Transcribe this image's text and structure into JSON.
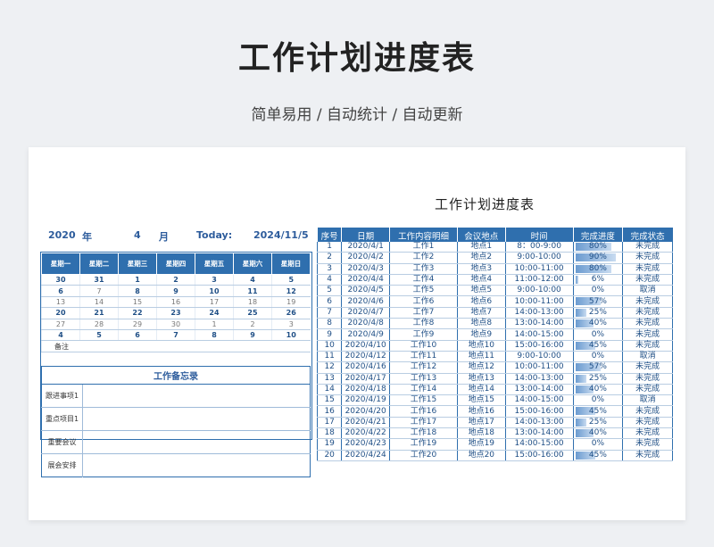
{
  "header": {
    "title": "工作计划进度表",
    "subtitle": "简单易用  /  自动统计  /  自动更新"
  },
  "sheet": {
    "title": "工作计划进度表",
    "year": "2020",
    "year_unit": "年",
    "month": "4",
    "month_unit": "月",
    "today_label": "Today:",
    "today_value": "2024/11/5"
  },
  "calendar": {
    "weekdays": [
      "星期一",
      "星期二",
      "星期三",
      "星期四",
      "星期五",
      "星期六",
      "星期日"
    ],
    "weeks": [
      [
        {
          "d": "30",
          "m": false
        },
        {
          "d": "31",
          "m": false
        },
        {
          "d": "1",
          "m": false
        },
        {
          "d": "2",
          "m": false
        },
        {
          "d": "3",
          "m": false
        },
        {
          "d": "4",
          "m": false
        },
        {
          "d": "5",
          "m": false
        }
      ],
      [
        {
          "d": "6",
          "m": false
        },
        {
          "d": "7",
          "m": true
        },
        {
          "d": "8",
          "m": false
        },
        {
          "d": "9",
          "m": false
        },
        {
          "d": "10",
          "m": false
        },
        {
          "d": "11",
          "m": false
        },
        {
          "d": "12",
          "m": false
        }
      ],
      [
        {
          "d": "13",
          "m": true
        },
        {
          "d": "14",
          "m": true
        },
        {
          "d": "15",
          "m": true
        },
        {
          "d": "16",
          "m": true
        },
        {
          "d": "17",
          "m": true
        },
        {
          "d": "18",
          "m": true
        },
        {
          "d": "19",
          "m": true
        }
      ],
      [
        {
          "d": "20",
          "m": false
        },
        {
          "d": "21",
          "m": false
        },
        {
          "d": "22",
          "m": false
        },
        {
          "d": "23",
          "m": false
        },
        {
          "d": "24",
          "m": false
        },
        {
          "d": "25",
          "m": false
        },
        {
          "d": "26",
          "m": false
        }
      ],
      [
        {
          "d": "27",
          "m": true
        },
        {
          "d": "28",
          "m": true
        },
        {
          "d": "29",
          "m": true
        },
        {
          "d": "30",
          "m": true
        },
        {
          "d": "1",
          "m": true
        },
        {
          "d": "2",
          "m": true
        },
        {
          "d": "3",
          "m": true
        }
      ],
      [
        {
          "d": "4",
          "m": false
        },
        {
          "d": "5",
          "m": false
        },
        {
          "d": "6",
          "m": false
        },
        {
          "d": "7",
          "m": false
        },
        {
          "d": "8",
          "m": false
        },
        {
          "d": "9",
          "m": false
        },
        {
          "d": "10",
          "m": false
        }
      ]
    ],
    "note_label": "备注"
  },
  "memo": {
    "title": "工作备忘录",
    "rows": [
      "跟进事项1",
      "重点项目1",
      "重要会议",
      "展会安排"
    ]
  },
  "plan": {
    "headers": [
      "序号",
      "日期",
      "工作内容明细",
      "会议地点",
      "时间",
      "完成进度",
      "完成状态"
    ],
    "rows": [
      [
        "1",
        "2020/4/1",
        "工作1",
        "地点1",
        "8：00-9:00",
        "80%",
        0.8,
        "未完成"
      ],
      [
        "2",
        "2020/4/2",
        "工作2",
        "地点2",
        "9:00-10:00",
        "90%",
        0.9,
        "未完成"
      ],
      [
        "3",
        "2020/4/3",
        "工作3",
        "地点3",
        "10:00-11:00",
        "80%",
        0.8,
        "未完成"
      ],
      [
        "4",
        "2020/4/4",
        "工作4",
        "地点4",
        "11:00-12:00",
        "6%",
        0.06,
        "未完成"
      ],
      [
        "5",
        "2020/4/5",
        "工作5",
        "地点5",
        "9:00-10:00",
        "0%",
        0,
        "取消"
      ],
      [
        "6",
        "2020/4/6",
        "工作6",
        "地点6",
        "10:00-11:00",
        "57%",
        0.57,
        "未完成"
      ],
      [
        "7",
        "2020/4/7",
        "工作7",
        "地点7",
        "14:00-13:00",
        "25%",
        0.25,
        "未完成"
      ],
      [
        "8",
        "2020/4/8",
        "工作8",
        "地点8",
        "13:00-14:00",
        "40%",
        0.4,
        "未完成"
      ],
      [
        "9",
        "2020/4/9",
        "工作9",
        "地点9",
        "14:00-15:00",
        "0%",
        0,
        "未完成"
      ],
      [
        "10",
        "2020/4/10",
        "工作10",
        "地点10",
        "15:00-16:00",
        "45%",
        0.45,
        "未完成"
      ],
      [
        "11",
        "2020/4/12",
        "工作11",
        "地点11",
        "9:00-10:00",
        "0%",
        0,
        "取消"
      ],
      [
        "12",
        "2020/4/16",
        "工作12",
        "地点12",
        "10:00-11:00",
        "57%",
        0.57,
        "未完成"
      ],
      [
        "13",
        "2020/4/17",
        "工作13",
        "地点13",
        "14:00-13:00",
        "25%",
        0.25,
        "未完成"
      ],
      [
        "14",
        "2020/4/18",
        "工作14",
        "地点14",
        "13:00-14:00",
        "40%",
        0.4,
        "未完成"
      ],
      [
        "15",
        "2020/4/19",
        "工作15",
        "地点15",
        "14:00-15:00",
        "0%",
        0,
        "取消"
      ],
      [
        "16",
        "2020/4/20",
        "工作16",
        "地点16",
        "15:00-16:00",
        "45%",
        0.45,
        "未完成"
      ],
      [
        "17",
        "2020/4/21",
        "工作17",
        "地点17",
        "14:00-13:00",
        "25%",
        0.25,
        "未完成"
      ],
      [
        "18",
        "2020/4/22",
        "工作18",
        "地点18",
        "13:00-14:00",
        "40%",
        0.4,
        "未完成"
      ],
      [
        "19",
        "2020/4/23",
        "工作19",
        "地点19",
        "14:00-15:00",
        "0%",
        0,
        "未完成"
      ],
      [
        "20",
        "2020/4/24",
        "工作20",
        "地点20",
        "15:00-16:00",
        "45%",
        0.45,
        "未完成"
      ]
    ]
  }
}
